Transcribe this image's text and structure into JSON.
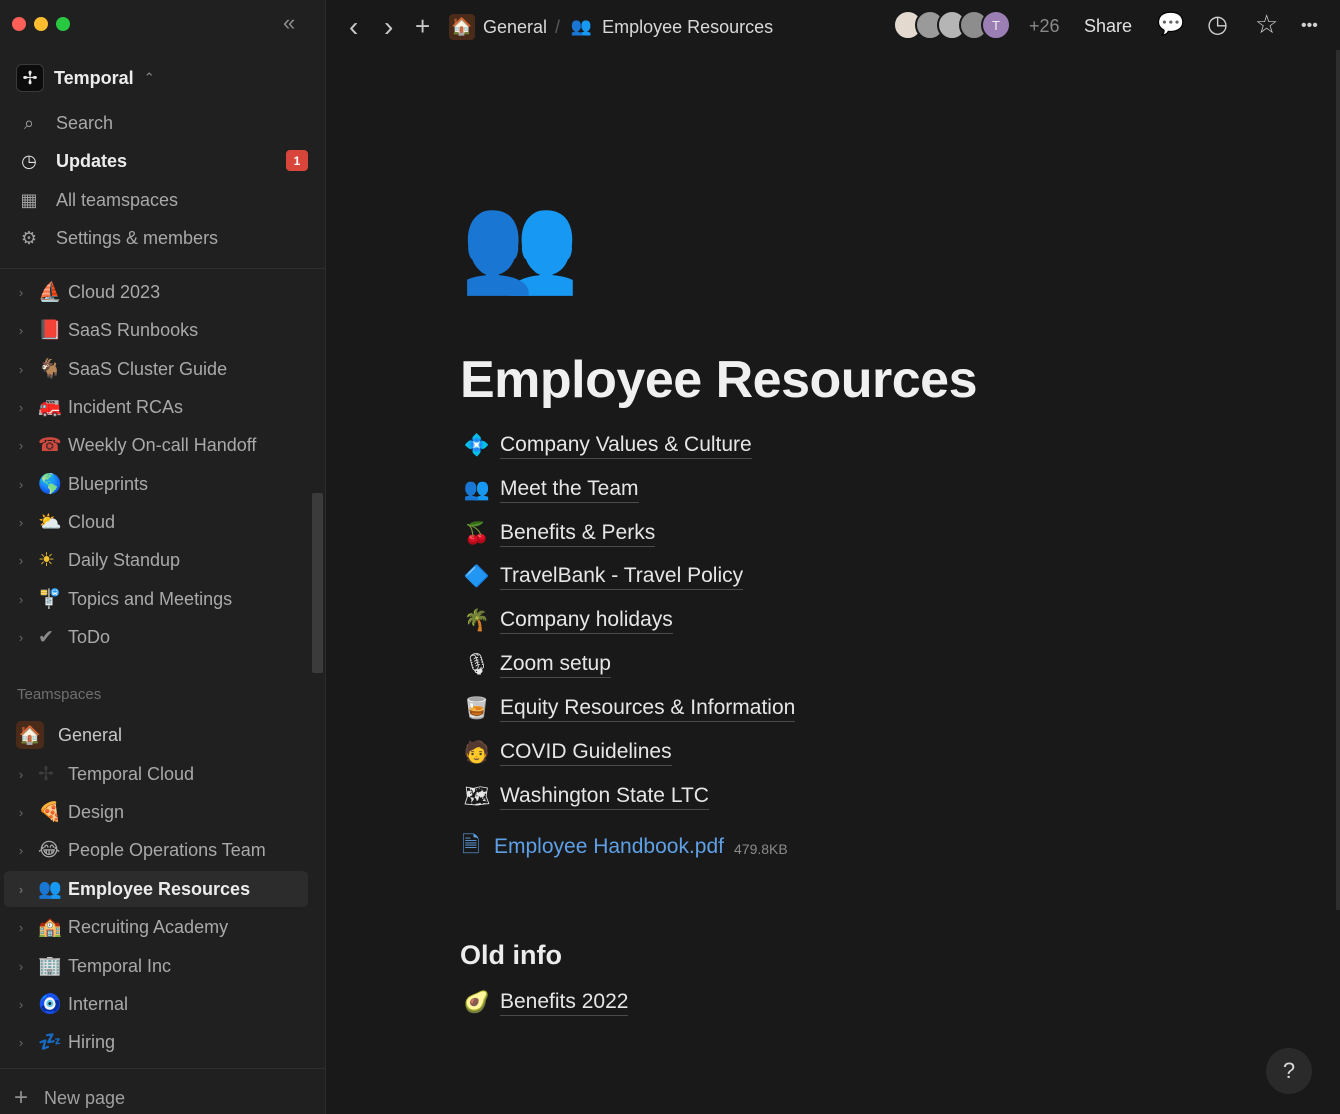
{
  "window": {
    "collapse_glyph": "«"
  },
  "workspace": {
    "name": "Temporal",
    "logo_glyph": "✢",
    "switch_glyph": "⌃"
  },
  "sidebar": {
    "top_items": [
      {
        "label": "Search",
        "icon": "search-icon",
        "glyph": "⌕"
      },
      {
        "label": "Updates",
        "icon": "clock-icon",
        "glyph": "◷",
        "badge": "1"
      },
      {
        "label": "All teamspaces",
        "icon": "building-icon",
        "glyph": "▦"
      },
      {
        "label": "Settings & members",
        "icon": "gear-icon",
        "glyph": "⚙"
      }
    ],
    "pages": [
      {
        "label": "Cloud 2023",
        "icon": "⛵"
      },
      {
        "label": "SaaS Runbooks",
        "icon": "📕"
      },
      {
        "label": "SaaS Cluster Guide",
        "icon": "🐐"
      },
      {
        "label": "Incident RCAs",
        "icon": "🚒"
      },
      {
        "label": "Weekly On-call Handoff",
        "icon": "☎"
      },
      {
        "label": "Blueprints",
        "icon": "🌎"
      },
      {
        "label": "Cloud",
        "icon": "⛅"
      },
      {
        "label": "Daily Standup",
        "icon": "☀"
      },
      {
        "label": "Topics and Meetings",
        "icon": "🚏"
      },
      {
        "label": "ToDo",
        "icon": "✔"
      }
    ],
    "teamspaces_label": "Teamspaces",
    "general": {
      "label": "General",
      "icon": "🏠"
    },
    "teamspace_pages": [
      {
        "label": "Temporal Cloud",
        "icon": "✢"
      },
      {
        "label": "Design",
        "icon": "🍕"
      },
      {
        "label": "People Operations Team",
        "icon": "😂"
      },
      {
        "label": "Employee Resources",
        "icon": "👥",
        "active": true
      },
      {
        "label": "Recruiting Academy",
        "icon": "🏫"
      },
      {
        "label": "Temporal Inc",
        "icon": "🏢"
      },
      {
        "label": "Internal",
        "icon": "🧿"
      },
      {
        "label": "Hiring",
        "icon": "💤"
      }
    ],
    "chevron_glyph": "›",
    "new_page_label": "New page",
    "new_page_glyph": "+"
  },
  "topbar": {
    "back_glyph": "‹",
    "forward_glyph": "›",
    "add_glyph": "+",
    "breadcrumb": [
      {
        "label": "General",
        "icon": "🏠"
      },
      {
        "label": "Employee Resources",
        "icon": "👥"
      }
    ],
    "breadcrumb_sep": "/",
    "avatars": [
      "",
      "",
      "",
      "",
      "T"
    ],
    "more_count": "+26",
    "share_label": "Share",
    "comment_glyph": "💬",
    "history_glyph": "◷",
    "star_glyph": "☆",
    "more_glyph": "•••"
  },
  "page": {
    "icon": "👥",
    "title": "Employee Resources",
    "links": [
      {
        "label": "Company Values & Culture",
        "icon": "💠"
      },
      {
        "label": "Meet the Team",
        "icon": "👥"
      },
      {
        "label": "Benefits & Perks",
        "icon": "🍒"
      },
      {
        "label": "TravelBank - Travel Policy",
        "icon": "🔷"
      },
      {
        "label": "Company holidays",
        "icon": "🌴"
      },
      {
        "label": "Zoom setup",
        "icon": "🎙"
      },
      {
        "label": "Equity Resources & Information",
        "icon": "🥃"
      },
      {
        "label": "COVID Guidelines",
        "icon": "🧑"
      },
      {
        "label": "Washington State LTC",
        "icon": "🗺"
      }
    ],
    "file": {
      "name": "Employee Handbook.pdf",
      "size": "479.8KB",
      "glyph": "🗎"
    },
    "old_info_heading": "Old info",
    "old_links": [
      {
        "label": "Benefits 2022",
        "icon": "🥑"
      }
    ]
  },
  "help_glyph": "?"
}
